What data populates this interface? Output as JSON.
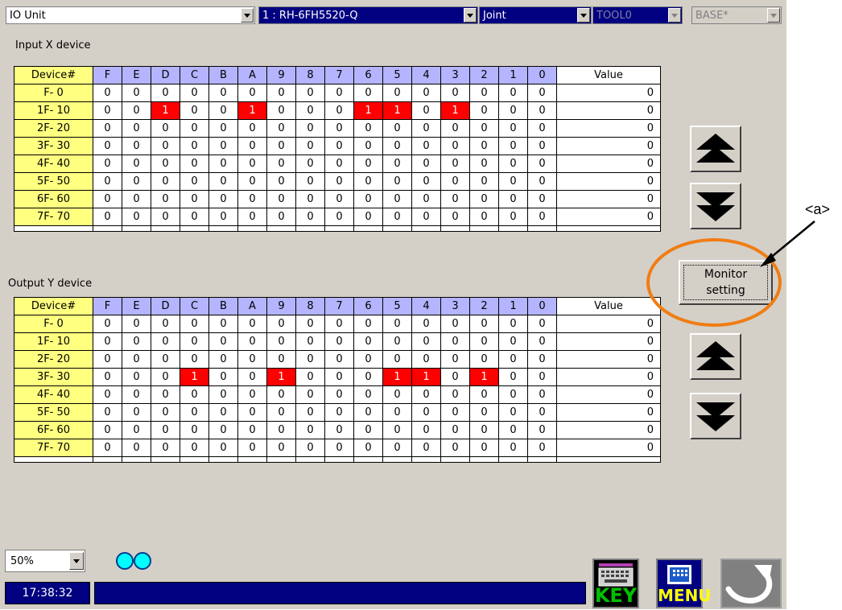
{
  "top_bar": {
    "unit_select": "IO Unit",
    "robot_select": "1 : RH-6FH5520-Q",
    "mode_select": "Joint",
    "tool_select": "TOOL0",
    "base_select": "BASE*"
  },
  "input": {
    "label": "Input X device",
    "header_device": "Device#",
    "header_value": "Value",
    "columns": [
      "F",
      "E",
      "D",
      "C",
      "B",
      "A",
      "9",
      "8",
      "7",
      "6",
      "5",
      "4",
      "3",
      "2",
      "1",
      "0"
    ],
    "rows": [
      {
        "device": "F- 0",
        "bits": [
          0,
          0,
          0,
          0,
          0,
          0,
          0,
          0,
          0,
          0,
          0,
          0,
          0,
          0,
          0,
          0
        ],
        "value": "0"
      },
      {
        "device": "1F- 10",
        "bits": [
          0,
          0,
          1,
          0,
          0,
          1,
          0,
          0,
          0,
          1,
          1,
          0,
          1,
          0,
          0,
          0
        ],
        "value": "0"
      },
      {
        "device": "2F- 20",
        "bits": [
          0,
          0,
          0,
          0,
          0,
          0,
          0,
          0,
          0,
          0,
          0,
          0,
          0,
          0,
          0,
          0
        ],
        "value": "0"
      },
      {
        "device": "3F- 30",
        "bits": [
          0,
          0,
          0,
          0,
          0,
          0,
          0,
          0,
          0,
          0,
          0,
          0,
          0,
          0,
          0,
          0
        ],
        "value": "0"
      },
      {
        "device": "4F- 40",
        "bits": [
          0,
          0,
          0,
          0,
          0,
          0,
          0,
          0,
          0,
          0,
          0,
          0,
          0,
          0,
          0,
          0
        ],
        "value": "0"
      },
      {
        "device": "5F- 50",
        "bits": [
          0,
          0,
          0,
          0,
          0,
          0,
          0,
          0,
          0,
          0,
          0,
          0,
          0,
          0,
          0,
          0
        ],
        "value": "0"
      },
      {
        "device": "6F- 60",
        "bits": [
          0,
          0,
          0,
          0,
          0,
          0,
          0,
          0,
          0,
          0,
          0,
          0,
          0,
          0,
          0,
          0
        ],
        "value": "0"
      },
      {
        "device": "7F- 70",
        "bits": [
          0,
          0,
          0,
          0,
          0,
          0,
          0,
          0,
          0,
          0,
          0,
          0,
          0,
          0,
          0,
          0
        ],
        "value": "0"
      }
    ]
  },
  "output": {
    "label": "Output Y device",
    "header_device": "Device#",
    "header_value": "Value",
    "columns": [
      "F",
      "E",
      "D",
      "C",
      "B",
      "A",
      "9",
      "8",
      "7",
      "6",
      "5",
      "4",
      "3",
      "2",
      "1",
      "0"
    ],
    "rows": [
      {
        "device": "F- 0",
        "bits": [
          0,
          0,
          0,
          0,
          0,
          0,
          0,
          0,
          0,
          0,
          0,
          0,
          0,
          0,
          0,
          0
        ],
        "value": "0"
      },
      {
        "device": "1F- 10",
        "bits": [
          0,
          0,
          0,
          0,
          0,
          0,
          0,
          0,
          0,
          0,
          0,
          0,
          0,
          0,
          0,
          0
        ],
        "value": "0"
      },
      {
        "device": "2F- 20",
        "bits": [
          0,
          0,
          0,
          0,
          0,
          0,
          0,
          0,
          0,
          0,
          0,
          0,
          0,
          0,
          0,
          0
        ],
        "value": "0"
      },
      {
        "device": "3F- 30",
        "bits": [
          0,
          0,
          0,
          1,
          0,
          0,
          1,
          0,
          0,
          0,
          1,
          1,
          0,
          1,
          0,
          0
        ],
        "value": "0"
      },
      {
        "device": "4F- 40",
        "bits": [
          0,
          0,
          0,
          0,
          0,
          0,
          0,
          0,
          0,
          0,
          0,
          0,
          0,
          0,
          0,
          0
        ],
        "value": "0"
      },
      {
        "device": "5F- 50",
        "bits": [
          0,
          0,
          0,
          0,
          0,
          0,
          0,
          0,
          0,
          0,
          0,
          0,
          0,
          0,
          0,
          0
        ],
        "value": "0"
      },
      {
        "device": "6F- 60",
        "bits": [
          0,
          0,
          0,
          0,
          0,
          0,
          0,
          0,
          0,
          0,
          0,
          0,
          0,
          0,
          0,
          0
        ],
        "value": "0"
      },
      {
        "device": "7F- 70",
        "bits": [
          0,
          0,
          0,
          0,
          0,
          0,
          0,
          0,
          0,
          0,
          0,
          0,
          0,
          0,
          0,
          0
        ],
        "value": "0"
      }
    ]
  },
  "monitor_button": {
    "line1": "Monitor",
    "line2": "setting"
  },
  "zoom": "50%",
  "clock": "17:38:32",
  "bottom_buttons": {
    "key": "KEY",
    "menu": "MENU"
  },
  "annotation": "<a>",
  "icons": {
    "input_up": "page-up-icon",
    "input_down": "page-down-icon",
    "output_up": "page-up-icon",
    "output_down": "page-down-icon",
    "key": "keyboard-icon",
    "menu": "menu-grid-icon",
    "back": "back-arrow-icon"
  },
  "colors": {
    "bit_on": "#ff0000",
    "device_col": "#ffff80",
    "header_col": "#b4b4ff",
    "status_bar": "#000080",
    "highlight": "#f07d14",
    "led": "#00ffff"
  }
}
